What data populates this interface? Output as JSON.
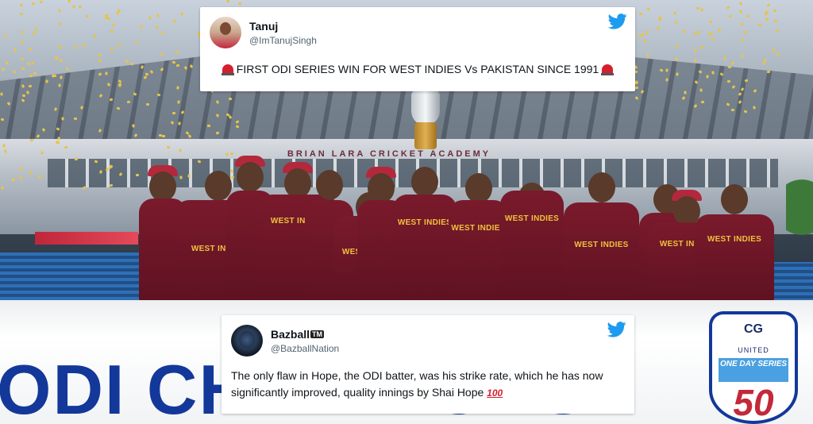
{
  "tweets": [
    {
      "name": "Tanuj",
      "handle": "@ImTanujSingh",
      "text": "FIRST ODI SERIES WIN FOR WEST INDIES Vs PAKISTAN SINCE 1991",
      "emoji": "siren"
    },
    {
      "name": "Bazball",
      "name_suffix": "TM",
      "handle": "@BazballNation",
      "text": "The only flaw in Hope, the ODI batter, was his strike rate, which he has now significantly improved, quality innings by Shai Hope",
      "emoji": "100"
    }
  ],
  "photo": {
    "stadium_sign": "BRIAN LARA CRICKET ACADEMY",
    "jersey_text": "WEST INDIES",
    "banner_text": "ODI CHAMPIONS",
    "badge": {
      "brand": "CG",
      "line1": "UNITED",
      "line2": "ONE DAY SERIES",
      "number": "50"
    }
  },
  "colors": {
    "twitter_blue": "#1d9bf0",
    "jersey_maroon": "#7a1a2c",
    "banner_blue": "#13389a"
  },
  "icons": {
    "brand": "twitter-bird-icon"
  }
}
